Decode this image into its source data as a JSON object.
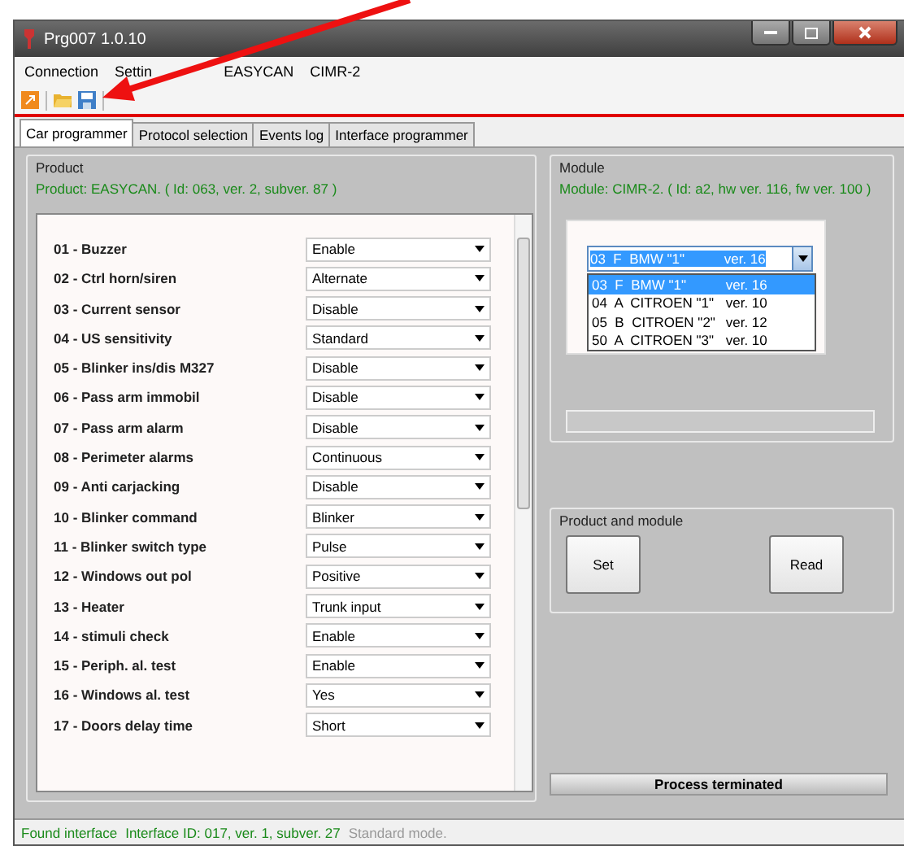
{
  "window": {
    "title": "Prg007  1.0.10"
  },
  "menu": [
    "Connection",
    "Settin",
    "EASYCAN",
    "CIMR-2"
  ],
  "tabs": [
    {
      "label": "Car programmer",
      "selected": true
    },
    {
      "label": "Protocol selection",
      "selected": false
    },
    {
      "label": "Events log",
      "selected": false
    },
    {
      "label": "Interface programmer",
      "selected": false
    }
  ],
  "product": {
    "legend": "Product",
    "info": "Product: EASYCAN. ( Id: 063, ver. 2, subver. 87 )",
    "parameters": [
      {
        "label": "01 - Buzzer",
        "value": "Enable"
      },
      {
        "label": "02 - Ctrl horn/siren",
        "value": "Alternate"
      },
      {
        "label": "03 - Current sensor",
        "value": "Disable"
      },
      {
        "label": "04 - US sensitivity",
        "value": "Standard"
      },
      {
        "label": "05 - Blinker ins/dis M327",
        "value": "Disable"
      },
      {
        "label": "06 - Pass arm immobil",
        "value": "Disable"
      },
      {
        "label": "07 - Pass arm alarm",
        "value": "Disable"
      },
      {
        "label": "08 - Perimeter alarms",
        "value": "Continuous"
      },
      {
        "label": "09 - Anti carjacking",
        "value": "Disable"
      },
      {
        "label": "10 - Blinker command",
        "value": "Blinker"
      },
      {
        "label": "11 - Blinker switch type",
        "value": "Pulse"
      },
      {
        "label": "12 - Windows out pol",
        "value": "Positive"
      },
      {
        "label": "13 - Heater",
        "value": "Trunk input"
      },
      {
        "label": "14 - stimuli check",
        "value": "Enable"
      },
      {
        "label": "15 - Periph. al. test",
        "value": "Enable"
      },
      {
        "label": "16 - Windows al. test",
        "value": "Yes"
      },
      {
        "label": "17 - Doors delay time",
        "value": "Short"
      }
    ]
  },
  "module": {
    "legend": "Module",
    "info": "Module: CIMR-2. ( Id: a2, hw ver. 116, fw ver. 100 )",
    "combo": {
      "name": "03  F  BMW \"1\"",
      "version": "ver. 16",
      "options": [
        {
          "name": "03  F  BMW \"1\"",
          "version": "ver. 16",
          "selected": true
        },
        {
          "name": "04  A  CITROEN \"1\"",
          "version": "ver. 10",
          "selected": false
        },
        {
          "name": "05  B  CITROEN \"2\"",
          "version": "ver. 12",
          "selected": false
        },
        {
          "name": "50  A  CITROEN \"3\"",
          "version": "ver. 10",
          "selected": false
        }
      ]
    },
    "progress": {
      "level": 0
    }
  },
  "product_and_module": {
    "legend": "Product and module",
    "buttons": [
      "Set",
      "Read"
    ]
  },
  "process_status": "Process terminated",
  "status_bar": [
    {
      "text": "Found interface",
      "kind": "ok"
    },
    {
      "text": "Interface ID: 017, ver. 1, subver. 27",
      "kind": "ok"
    },
    {
      "text": "Standard mode.",
      "kind": "muted"
    }
  ]
}
